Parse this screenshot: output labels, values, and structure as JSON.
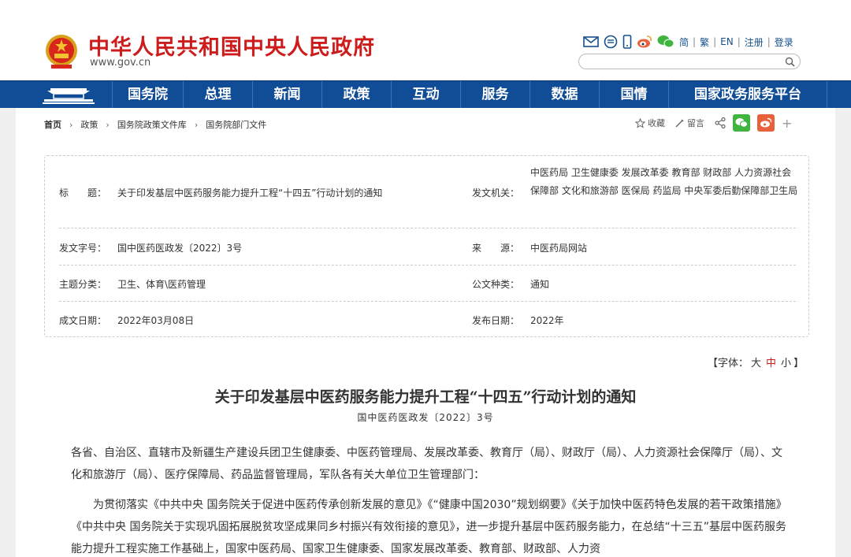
{
  "header": {
    "site_title": "中华人民共和国中央人民政府",
    "site_url": "www.gov.cn",
    "languages": [
      "简",
      "繁",
      "EN",
      "注册",
      "登录"
    ],
    "search_placeholder": ""
  },
  "nav": {
    "items": [
      "国务院",
      "总理",
      "新闻",
      "政策",
      "互动",
      "服务",
      "数据",
      "国情",
      "国家政务服务平台"
    ]
  },
  "breadcrumb": [
    "首页",
    "政策",
    "国务院政策文件库",
    "国务院部门文件"
  ],
  "page_tools": {
    "collect_label": "收藏",
    "comment_label": "留言"
  },
  "info": {
    "title_label": "标　　题：",
    "title_value": "关于印发基层中医药服务能力提升工程“十四五”行动计划的通知",
    "issuer_label": "发文机关：",
    "issuer_value": "中医药局 卫生健康委 发展改革委 教育部 财政部 人力资源社会保障部 文化和旅游部 医保局 药监局 中央军委后勤保障部卫生局",
    "docno_label": "发文字号：",
    "docno_value": "国中医药医政发〔2022〕3号",
    "source_label": "来　　源：",
    "source_value": "中医药局网站",
    "topic_label": "主题分类：",
    "topic_value": "卫生、体育\\医药管理",
    "type_label": "公文种类：",
    "type_value": "通知",
    "date_label": "成文日期：",
    "date_value": "2022年03月08日",
    "publish_label": "发布日期：",
    "publish_value": "2022年"
  },
  "font_bar": {
    "prefix": "【字体：",
    "large": "大",
    "medium": "中",
    "small": "小",
    "suffix": "】"
  },
  "article": {
    "title": "关于印发基层中医药服务能力提升工程“十四五”行动计划的通知",
    "docno": "国中医药医政发〔2022〕3号",
    "para1": "各省、自治区、直辖市及新疆生产建设兵团卫生健康委、中医药管理局、发展改革委、教育厅（局）、财政厅（局）、人力资源社会保障厅（局）、文化和旅游厅（局）、医疗保障局、药品监督管理局，军队各有关大单位卫生管理部门：",
    "para2": "为贯彻落实《中共中央 国务院关于促进中医药传承创新发展的意见》《“健康中国2030”规划纲要》《关于加快中医药特色发展的若干政策措施》《中共中央 国务院关于实现巩固拓展脱贫攻坚成果同乡村振兴有效衔接的意见》，进一步提升基层中医药服务能力，在总结“十三五”基层中医药服务能力提升工程实施工作基础上，国家中医药局、国家卫生健康委、国家发展改革委、教育部、财政部、人力资"
  },
  "colors": {
    "brand_red": "#cc1c1c",
    "nav_blue": "#114d96",
    "link_blue": "#154f8e",
    "wechat_green": "#3fb53f",
    "weibo_orange": "#e8613a"
  }
}
